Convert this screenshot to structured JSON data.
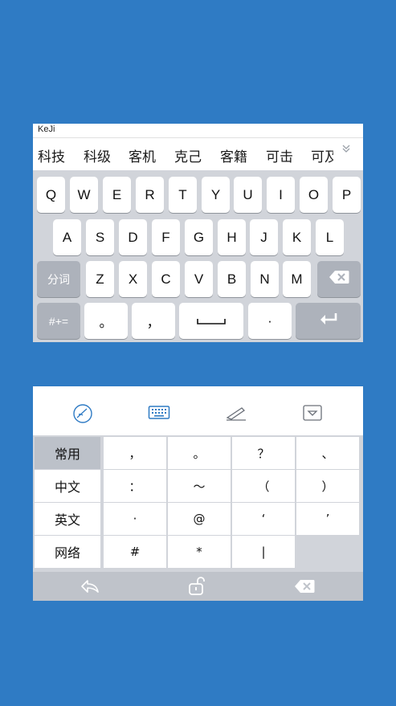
{
  "keyboard1": {
    "composition": "KeJi",
    "candidates": [
      "科技",
      "科级",
      "客机",
      "克己",
      "客籍",
      "可击",
      "可及"
    ],
    "candidate_more_icon": "chevron-double-down",
    "row1": [
      "Q",
      "W",
      "E",
      "R",
      "T",
      "Y",
      "U",
      "I",
      "O",
      "P"
    ],
    "row2": [
      "A",
      "S",
      "D",
      "F",
      "G",
      "H",
      "J",
      "K",
      "L"
    ],
    "row3": [
      "Z",
      "X",
      "C",
      "V",
      "B",
      "N",
      "M"
    ],
    "segment_key": "分词",
    "symbol_key": "#+=",
    "period_key": "。",
    "comma_key": "，",
    "dot_key": "·",
    "delete_icon": "backspace-icon",
    "return_icon": "return-arrow-icon"
  },
  "keyboard2": {
    "toolbar_icons": [
      "emoji-icon",
      "keyboard-icon",
      "handwriting-icon",
      "collapse-icon"
    ],
    "categories": [
      "常用",
      "中文",
      "英文",
      "网络"
    ],
    "active_category": "常用",
    "symbols": [
      [
        "，",
        "。",
        "？",
        "、"
      ],
      [
        "：",
        "～",
        "（",
        "）"
      ],
      [
        "·",
        "@",
        "‘",
        "’"
      ],
      [
        "#",
        "*",
        "|"
      ]
    ],
    "bottom_icons": [
      "back-icon",
      "lock-icon",
      "backspace-icon"
    ]
  },
  "colors": {
    "background": "#2f7bc4",
    "keyboard_bg": "#d1d4da",
    "function_key": "#adb2bb",
    "accent_icon": "#2f7bc4"
  }
}
